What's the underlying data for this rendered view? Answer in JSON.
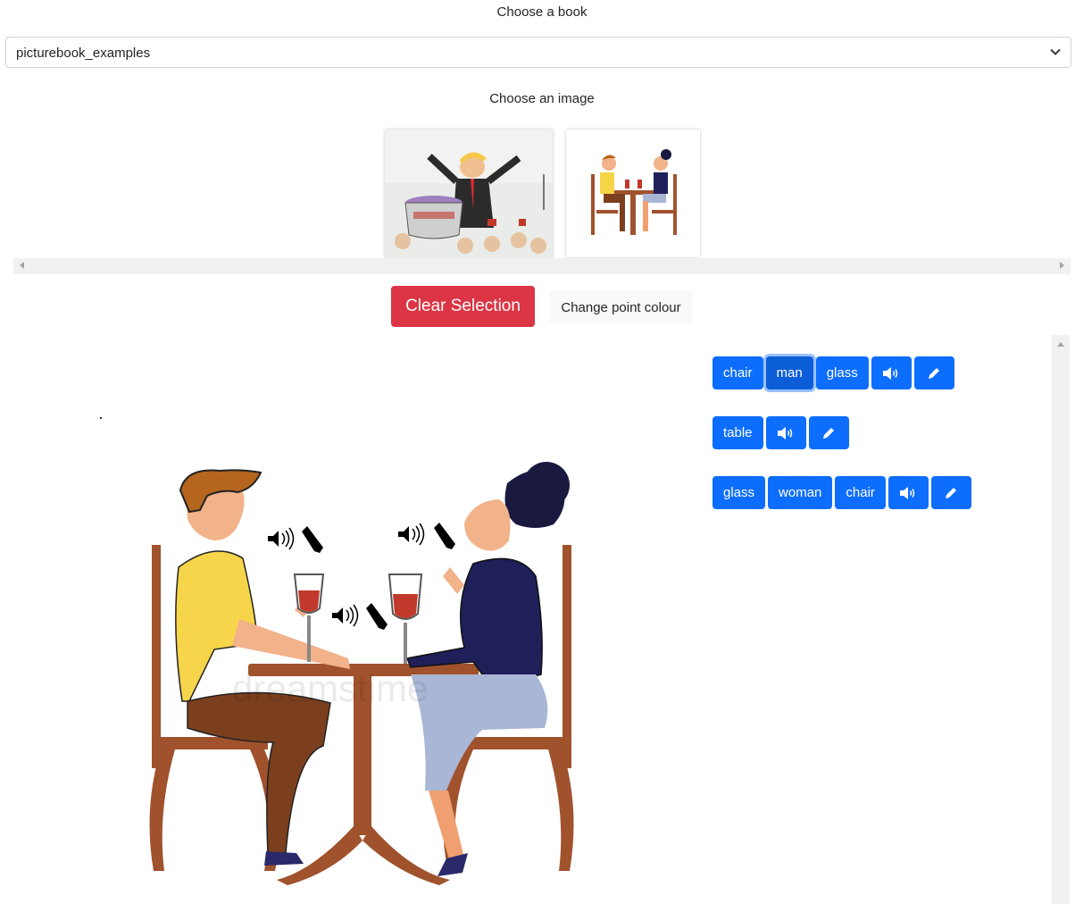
{
  "book": {
    "label": "Choose a book",
    "selected": "picturebook_examples"
  },
  "image_picker": {
    "label": "Choose an image",
    "thumbnails": [
      "cartoon-thumbnail",
      "couple-thumbnail"
    ]
  },
  "actions": {
    "clear": "Clear Selection",
    "colour": "Change point colour"
  },
  "tag_rows": [
    {
      "tags": [
        "chair",
        "man",
        "glass"
      ],
      "active": "man"
    },
    {
      "tags": [
        "table"
      ]
    },
    {
      "tags": [
        "glass",
        "woman",
        "chair"
      ]
    }
  ],
  "colors": {
    "primary": "#0d6efd",
    "danger": "#dc3545",
    "light": "#f8f9fa"
  },
  "icons": [
    "chevron-down-icon",
    "speaker-icon",
    "pencil-icon"
  ]
}
